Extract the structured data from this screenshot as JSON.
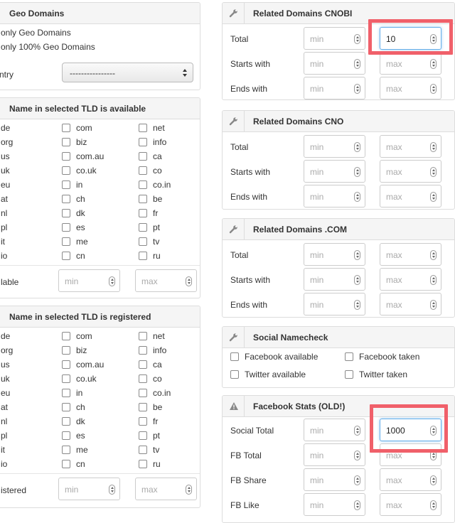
{
  "geo": {
    "title": "Geo Domains",
    "options": [
      "only Geo Domains",
      "only 100% Geo Domains"
    ],
    "country_label": "ntry",
    "country_value": "----------------"
  },
  "tld_available": {
    "title": "Name in selected TLD is available",
    "left_tlds": [
      "de",
      "org",
      "us",
      "uk",
      "eu",
      "at",
      "nl",
      "pl",
      "it",
      "io"
    ],
    "col2": [
      "com",
      "biz",
      "com.au",
      "co.uk",
      "in",
      "ch",
      "dk",
      "es",
      "me",
      "cn"
    ],
    "col3": [
      "net",
      "info",
      "ca",
      "co",
      "co.in",
      "be",
      "fr",
      "pt",
      "tv",
      "ru"
    ],
    "count_label": "lable",
    "min_placeholder": "min",
    "max_placeholder": "max"
  },
  "tld_registered": {
    "title": "Name in selected TLD is registered",
    "left_tlds": [
      "de",
      "org",
      "us",
      "uk",
      "eu",
      "at",
      "nl",
      "pl",
      "it",
      "io"
    ],
    "col2": [
      "com",
      "biz",
      "com.au",
      "co.uk",
      "in",
      "ch",
      "dk",
      "es",
      "me",
      "cn"
    ],
    "col3": [
      "net",
      "info",
      "ca",
      "co",
      "co.in",
      "be",
      "fr",
      "pt",
      "tv",
      "ru"
    ],
    "count_label": "istered",
    "min_placeholder": "min",
    "max_placeholder": "max"
  },
  "cnobi": {
    "title": "Related Domains CNOBI",
    "rows": [
      {
        "label": "Total",
        "min": "",
        "max": "10"
      },
      {
        "label": "Starts with",
        "min": "",
        "max": ""
      },
      {
        "label": "Ends with",
        "min": "",
        "max": ""
      }
    ]
  },
  "cno": {
    "title": "Related Domains CNO",
    "rows": [
      {
        "label": "Total",
        "min": "",
        "max": ""
      },
      {
        "label": "Starts with",
        "min": "",
        "max": ""
      },
      {
        "label": "Ends with",
        "min": "",
        "max": ""
      }
    ]
  },
  "dotcom": {
    "title": "Related Domains .COM",
    "rows": [
      {
        "label": "Total",
        "min": "",
        "max": ""
      },
      {
        "label": "Starts with",
        "min": "",
        "max": ""
      },
      {
        "label": "Ends with",
        "min": "",
        "max": ""
      }
    ]
  },
  "social": {
    "title": "Social Namecheck",
    "options": [
      "Facebook available",
      "Facebook taken",
      "Twitter available",
      "Twitter taken"
    ]
  },
  "facebook": {
    "title": "Facebook Stats (OLD!)",
    "rows": [
      {
        "label": "Social Total",
        "min": "",
        "max": "1000"
      },
      {
        "label": "FB Total",
        "min": "",
        "max": ""
      },
      {
        "label": "FB Share",
        "min": "",
        "max": ""
      },
      {
        "label": "FB Like",
        "min": "",
        "max": ""
      }
    ]
  },
  "placeholders": {
    "min": "min",
    "max": "max"
  },
  "icons": {
    "panel_icon": "wrench-icon",
    "warning_icon": "warning-icon"
  },
  "colors": {
    "highlight": "#f0606a",
    "focus": "#66afe9"
  }
}
